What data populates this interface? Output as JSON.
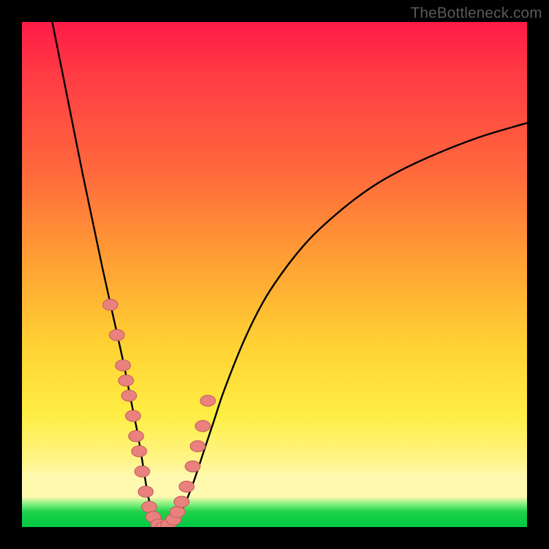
{
  "watermark": "TheBottleneck.com",
  "colors": {
    "frame": "#000000",
    "curve": "#000000",
    "marker_fill": "#e9817e",
    "marker_stroke": "#c45f5c",
    "gradient_stops": [
      "#ff1a46",
      "#ff6a3c",
      "#ffd233",
      "#fff9b0",
      "#00c843"
    ]
  },
  "chart_data": {
    "type": "line",
    "title": "",
    "xlabel": "",
    "ylabel": "",
    "xlim": [
      0,
      100
    ],
    "ylim": [
      0,
      100
    ],
    "grid": false,
    "legend": false,
    "series": [
      {
        "name": "bottleneck-curve",
        "x": [
          6,
          8,
          10,
          12,
          14,
          16,
          18,
          20,
          21,
          22,
          23,
          24,
          25,
          26,
          28,
          30,
          32,
          34,
          36,
          38,
          40,
          44,
          48,
          52,
          56,
          60,
          66,
          72,
          80,
          90,
          100
        ],
        "y": [
          100,
          90,
          80,
          70,
          60.5,
          51,
          42,
          33,
          28,
          23,
          18,
          12,
          6,
          3,
          0,
          1,
          4,
          9,
          15,
          21,
          27,
          37,
          45,
          51,
          56,
          60,
          65,
          69,
          73,
          77,
          80
        ]
      }
    ],
    "markers": {
      "name": "highlight-points",
      "x": [
        17.5,
        18.8,
        20.0,
        20.6,
        21.2,
        22.0,
        22.6,
        23.2,
        23.8,
        24.5,
        25.2,
        26.0,
        27.0,
        28.0,
        29.0,
        30.0,
        30.8,
        31.6,
        32.6,
        33.8,
        34.8,
        35.8,
        36.8
      ],
      "y": [
        44,
        38,
        32,
        29,
        26,
        22,
        18,
        15,
        11,
        7,
        4,
        2,
        0.5,
        0,
        0.5,
        1.5,
        3,
        5,
        8,
        12,
        16,
        20,
        25
      ]
    }
  }
}
